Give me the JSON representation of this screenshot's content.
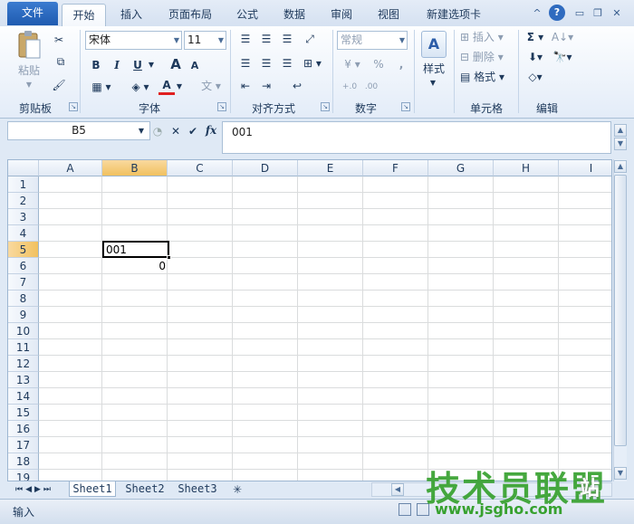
{
  "ribbon_tabs": [
    {
      "label": "文件"
    },
    {
      "label": "开始"
    },
    {
      "label": "插入"
    },
    {
      "label": "页面布局"
    },
    {
      "label": "公式"
    },
    {
      "label": "数据"
    },
    {
      "label": "审阅"
    },
    {
      "label": "视图"
    },
    {
      "label": "新建选项卡"
    }
  ],
  "window_icons": [
    "collapse-ribbon-icon",
    "help-icon",
    "minimize-icon",
    "restore-icon",
    "close-icon"
  ],
  "clipboard": {
    "paste": "粘贴",
    "group": "剪贴板"
  },
  "font": {
    "name": "宋体",
    "size": "11",
    "bold": "B",
    "italic": "I",
    "underline": "U",
    "grow": "A",
    "shrink": "A",
    "color_letter": "A",
    "wen": "文",
    "group": "字体"
  },
  "alignment": {
    "group": "对齐方式"
  },
  "number": {
    "format": "常规",
    "percent": "%",
    "comma": ",",
    "group": "数字"
  },
  "styles": {
    "label": "样式"
  },
  "cells": {
    "insert": "插入",
    "delete": "删除",
    "format": "格式",
    "group": "单元格"
  },
  "editing": {
    "sum": "Σ",
    "group": "编辑"
  },
  "formula_bar": {
    "name_box": "B5",
    "content": "001",
    "fx": "fx"
  },
  "columns": [
    "A",
    "B",
    "C",
    "D",
    "E",
    "F",
    "G",
    "H",
    "I"
  ],
  "rows": [
    "1",
    "2",
    "3",
    "4",
    "5",
    "6",
    "7",
    "8",
    "9",
    "10",
    "11",
    "12",
    "13",
    "14",
    "15",
    "16",
    "17",
    "18",
    "19"
  ],
  "cells_data": {
    "B5": "001",
    "B6": "0"
  },
  "sheets": [
    {
      "label": "Sheet1"
    },
    {
      "label": "Sheet2"
    },
    {
      "label": "Sheet3"
    }
  ],
  "status": {
    "mode": "输入"
  },
  "watermark": {
    "main": "技术员联盟",
    "url": "www.jsgho.com",
    "extra": "站"
  }
}
